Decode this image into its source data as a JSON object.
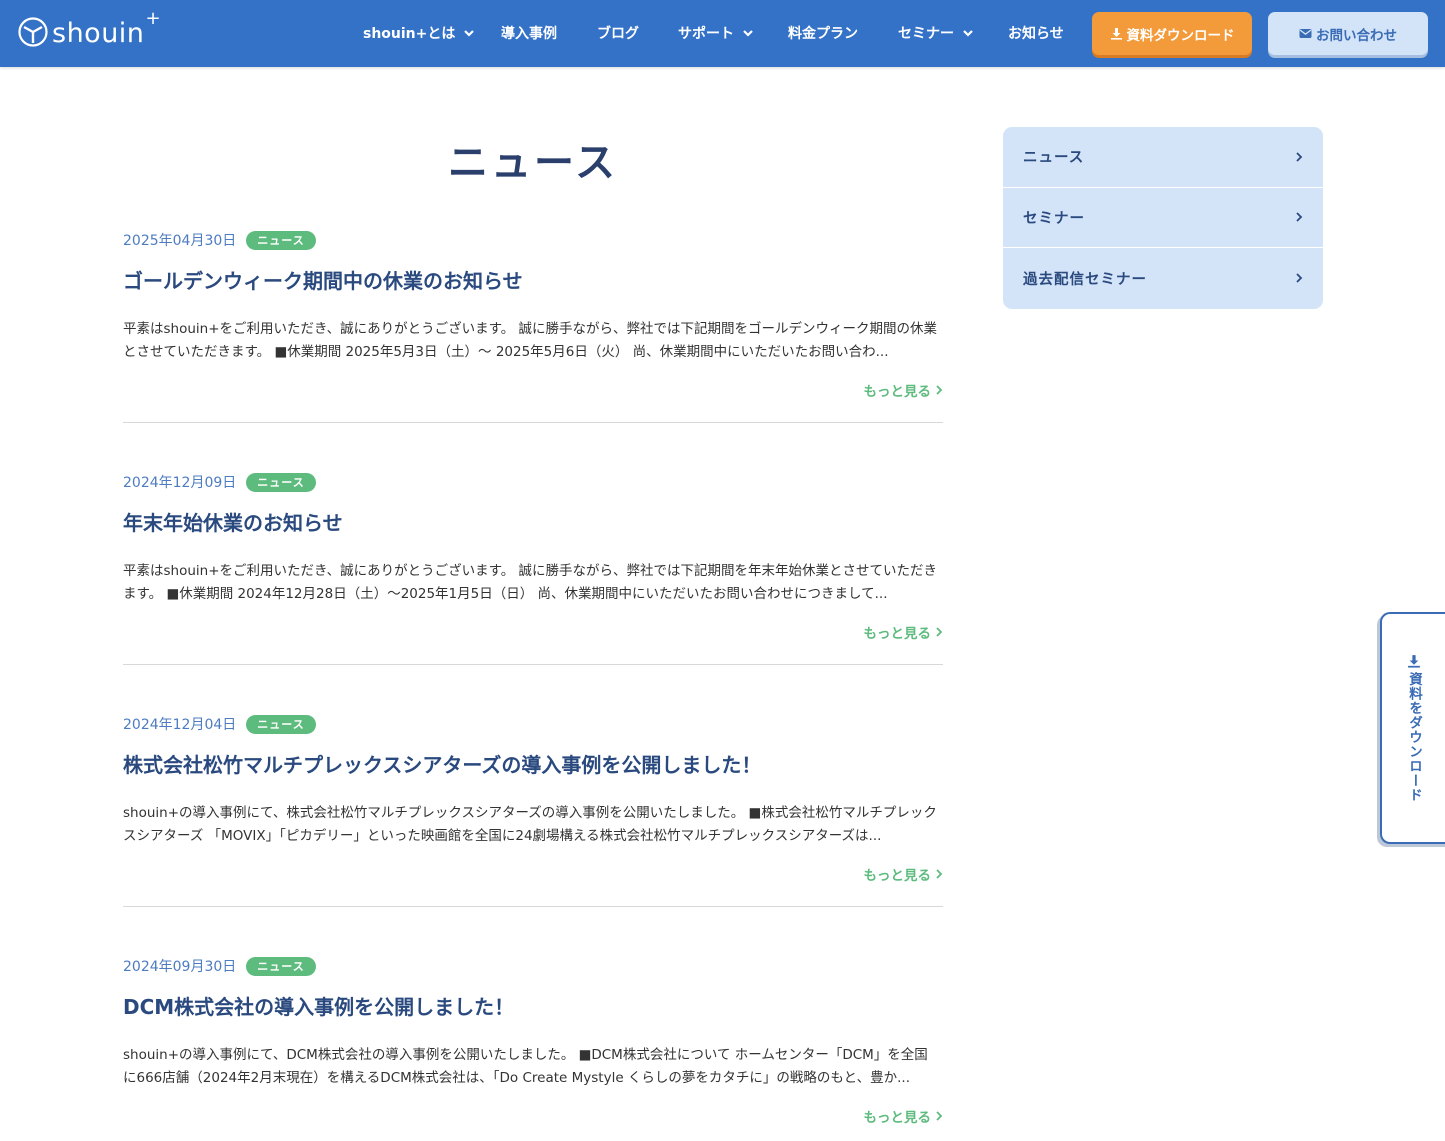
{
  "header": {
    "logo_text": "shouin",
    "logo_plus": "+",
    "nav": [
      {
        "label": "shouin+とは",
        "dropdown": true
      },
      {
        "label": "導入事例",
        "dropdown": false
      },
      {
        "label": "ブログ",
        "dropdown": false
      },
      {
        "label": "サポート",
        "dropdown": true
      },
      {
        "label": "料金プラン",
        "dropdown": false
      },
      {
        "label": "セミナー",
        "dropdown": true
      },
      {
        "label": "お知らせ",
        "dropdown": false
      }
    ],
    "download_label": "資料ダウンロード",
    "contact_label": "お問い合わせ"
  },
  "page": {
    "title": "ニュース"
  },
  "articles": [
    {
      "date": "2025年04月30日",
      "badge": "ニュース",
      "title": "ゴールデンウィーク期間中の休業のお知らせ",
      "body": "平素はshouin+をご利用いただき、誠にありがとうございます。 誠に勝手ながら、弊社では下記期間をゴールデンウィーク期間の休業とさせていただきます。 ■休業期間 2025年5月3日（土）〜 2025年5月6日（火） 尚、休業期間中にいただいたお問い合わ...",
      "more": "もっと見る"
    },
    {
      "date": "2024年12月09日",
      "badge": "ニュース",
      "title": "年末年始休業のお知らせ",
      "body": "平素はshouin+をご利用いただき、誠にありがとうございます。 誠に勝手ながら、弊社では下記期間を年末年始休業とさせていただきます。 ■休業期間 2024年12月28日（土）〜2025年1月5日（日） 尚、休業期間中にいただいたお問い合わせにつきまして...",
      "more": "もっと見る"
    },
    {
      "date": "2024年12月04日",
      "badge": "ニュース",
      "title": "株式会社松竹マルチプレックスシアターズの導入事例を公開しました！",
      "body": "shouin+の導入事例にて、株式会社松竹マルチプレックスシアターズの導入事例を公開いたしました。 ■株式会社松竹マルチプレックスシアターズ 「MOVIX」「ピカデリー」といった映画館を全国に24劇場構える株式会社松竹マルチプレックスシアターズは...",
      "more": "もっと見る"
    },
    {
      "date": "2024年09月30日",
      "badge": "ニュース",
      "title": "DCM株式会社の導入事例を公開しました！",
      "body": "shouin+の導入事例にて、DCM株式会社の導入事例を公開いたしました。 ■DCM株式会社について ホームセンター「DCM」を全国に666店舗（2024年2月末現在）を構えるDCM株式会社は、「Do Create Mystyle くらしの夢をカタチに」の戦略のもと、豊か...",
      "more": "もっと見る"
    }
  ],
  "sidebar": {
    "items": [
      {
        "label": "ニュース"
      },
      {
        "label": "セミナー"
      },
      {
        "label": "過去配信セミナー"
      }
    ]
  },
  "float_tab": {
    "label": "資料をダウンロード"
  },
  "colors": {
    "header_bg": "#3472c7",
    "download_btn": "#f39a3a",
    "contact_btn": "#d4e4f8",
    "badge": "#5dbb7e",
    "title_text": "#2a4a7f"
  },
  "icons": {
    "logo": "hanger-circle-icon",
    "dropdown": "chevron-down-icon",
    "download": "download-icon",
    "contact": "envelope-icon",
    "more": "chevron-right-icon"
  }
}
